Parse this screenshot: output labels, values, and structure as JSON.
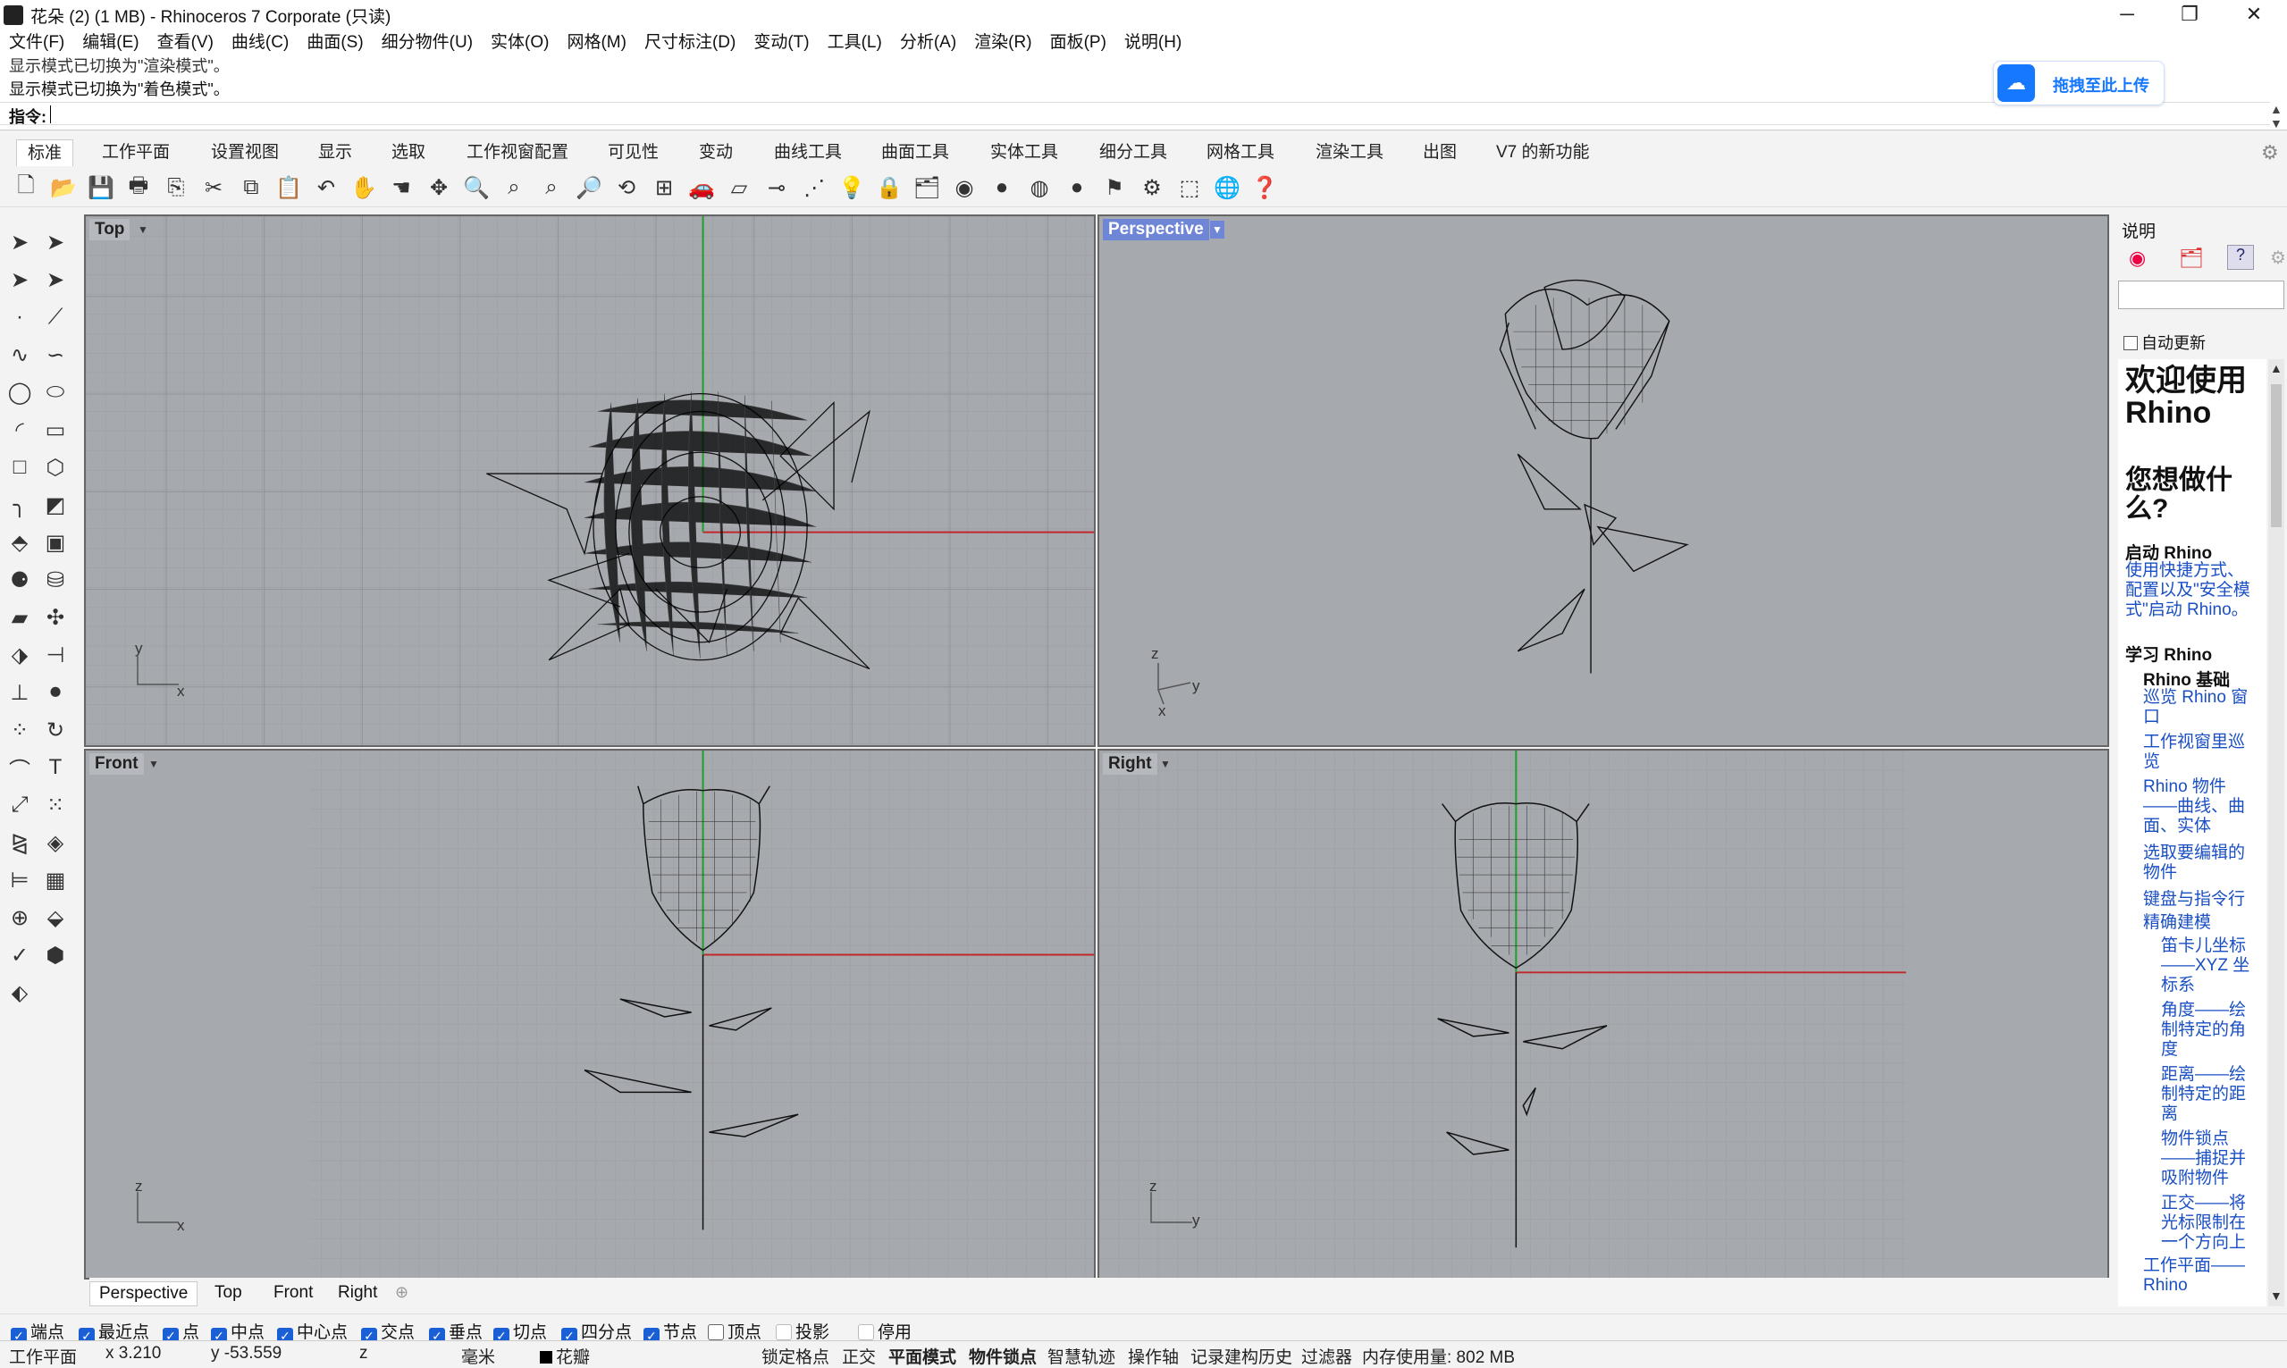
{
  "window": {
    "title": "花朵 (2) (1 MB) - Rhinoceros 7 Corporate (只读)",
    "minimize": "─",
    "maximize": "❐",
    "close": "✕"
  },
  "menu": [
    "文件(F)",
    "编辑(E)",
    "查看(V)",
    "曲线(C)",
    "曲面(S)",
    "细分物件(U)",
    "实体(O)",
    "网格(M)",
    "尺寸标注(D)",
    "变动(T)",
    "工具(L)",
    "分析(A)",
    "渲染(R)",
    "面板(P)",
    "说明(H)"
  ],
  "command": {
    "history1": "显示模式已切换为\"渲染模式\"。",
    "history2": "显示模式已切换为\"着色模式\"。",
    "prompt": "指令:"
  },
  "upload": {
    "label": "拖拽至此上传",
    "icon": "cloud-share-icon"
  },
  "tabs": [
    "标准",
    "工作平面",
    "设置视图",
    "显示",
    "选取",
    "工作视窗配置",
    "可见性",
    "变动",
    "曲线工具",
    "曲面工具",
    "实体工具",
    "细分工具",
    "网格工具",
    "渲染工具",
    "出图",
    "V7 的新功能"
  ],
  "viewports": {
    "top": {
      "label": "Top",
      "axis1": "y",
      "axis2": "x"
    },
    "perspective": {
      "label": "Perspective",
      "axis1": "z",
      "axis2": "y",
      "axis3": "x"
    },
    "front": {
      "label": "Front",
      "axis1": "z",
      "axis2": "x"
    },
    "right": {
      "label": "Right",
      "axis1": "z",
      "axis2": "y"
    }
  },
  "right_panel": {
    "title": "说明",
    "auto_update": "自动更新",
    "welcome": "欢迎使用 Rhino",
    "question": "您想做什么?",
    "section_start": "启动 Rhino",
    "start_link": "使用快捷方式、配置以及\"安全模式\"启动 Rhino。",
    "section_learn": "学习 Rhino",
    "basics": "Rhino 基础",
    "links": [
      "巡览 Rhino 窗口",
      "工作视窗里巡览",
      "Rhino 物件——曲线、曲面、实体",
      "选取要编辑的物件",
      "键盘与指令行",
      "精确建模"
    ],
    "sublinks": [
      "笛卡儿坐标——XYZ 坐标系",
      "角度——绘制特定的角度",
      "距离——绘制特定的距离",
      "物件锁点——捕捉并吸附物件",
      "正交——将光标限制在一个方向上"
    ],
    "last_link": "工作平面——Rhino"
  },
  "view_tabs": [
    "Perspective",
    "Top",
    "Front",
    "Right"
  ],
  "osnaps": [
    {
      "label": "端点",
      "on": true
    },
    {
      "label": "最近点",
      "on": true
    },
    {
      "label": "点",
      "on": true
    },
    {
      "label": "中点",
      "on": true
    },
    {
      "label": "中心点",
      "on": true
    },
    {
      "label": "交点",
      "on": true
    },
    {
      "label": "垂点",
      "on": true
    },
    {
      "label": "切点",
      "on": true
    },
    {
      "label": "四分点",
      "on": true
    },
    {
      "label": "节点",
      "on": true
    },
    {
      "label": "顶点",
      "on": false
    },
    {
      "label": "投影",
      "on": false
    },
    {
      "label": "停用",
      "on": false
    }
  ],
  "status": {
    "cplane": "工作平面",
    "x": "x 3.210",
    "y": "y -53.559",
    "z": "z",
    "units": "毫米",
    "layer": "花瓣",
    "layer_color": "#000000",
    "grid_snap": "锁定格点",
    "ortho": "正交",
    "planar": "平面模式",
    "osnap": "物件锁点",
    "smarttrack": "智慧轨迹",
    "gumball": "操作轴",
    "history": "记录建构历史",
    "filter": "过滤器",
    "memory": "内存使用量: 802 MB"
  },
  "colors": {
    "viewport_bg": "#a6a9ae",
    "x_axis": "#c0282a",
    "y_axis": "#1f9e2a",
    "active_label": "#6f86d6",
    "link": "#1a4fc4"
  }
}
